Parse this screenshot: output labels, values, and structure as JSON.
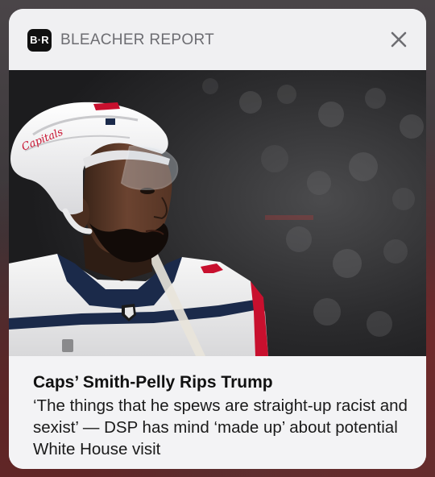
{
  "notification": {
    "app_icon_text": "B·R",
    "app_name": "BLEACHER REPORT",
    "close_icon": "close-icon",
    "photo_description_icon": "hockey-player-photo",
    "title": "Caps’ Smith-Pelly Rips Trump",
    "body": "‘The things that he spews are straight-up racist and sexist’ — DSP has mind ‘made up’ about potential White House visit",
    "helmet_lettering": "Capitals"
  },
  "colors": {
    "card_background": "#f3f3f5",
    "app_name_gray": "#6d6d72",
    "close_gray": "#6d6d72",
    "jersey_navy": "#1b2a4a",
    "helmet_white": "#f4f4f4",
    "capitals_red": "#c8102e"
  }
}
